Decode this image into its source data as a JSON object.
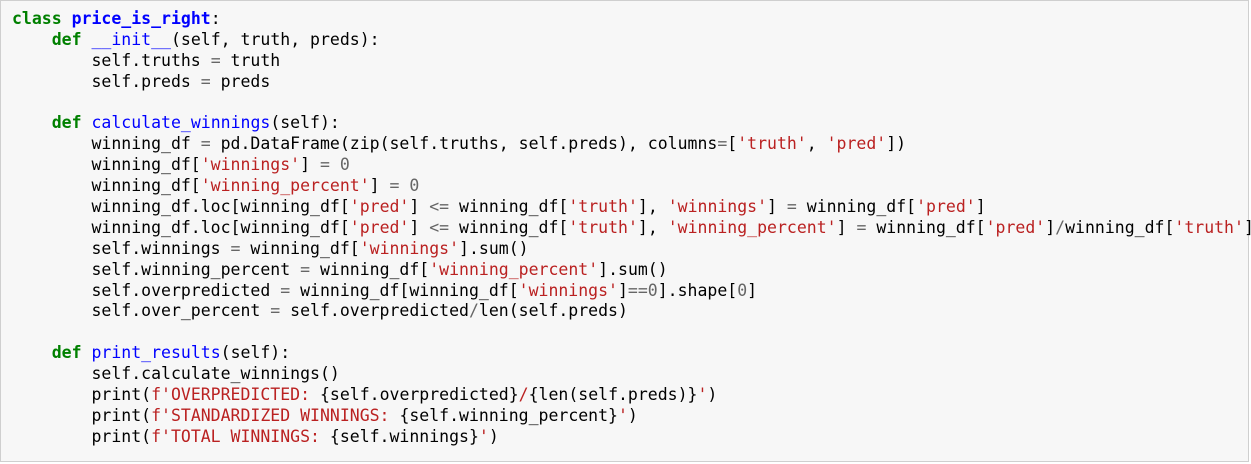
{
  "lines": [
    [
      [
        "k",
        "class"
      ],
      [
        "t",
        " "
      ],
      [
        "c",
        "price_is_right"
      ],
      [
        "t",
        ":"
      ]
    ],
    [
      [
        "t",
        "    "
      ],
      [
        "k",
        "def"
      ],
      [
        "t",
        " "
      ],
      [
        "f",
        "__init__"
      ],
      [
        "t",
        "(self, truth, preds):"
      ]
    ],
    [
      [
        "t",
        "        self.truths "
      ],
      [
        "o",
        "="
      ],
      [
        "t",
        " truth"
      ]
    ],
    [
      [
        "t",
        "        self.preds "
      ],
      [
        "o",
        "="
      ],
      [
        "t",
        " preds"
      ]
    ],
    [
      [
        "t",
        ""
      ]
    ],
    [
      [
        "t",
        "    "
      ],
      [
        "k",
        "def"
      ],
      [
        "t",
        " "
      ],
      [
        "f",
        "calculate_winnings"
      ],
      [
        "t",
        "(self):"
      ]
    ],
    [
      [
        "t",
        "        winning_df "
      ],
      [
        "o",
        "="
      ],
      [
        "t",
        " pd.DataFrame(zip(self.truths, self.preds), columns"
      ],
      [
        "o",
        "="
      ],
      [
        "t",
        "["
      ],
      [
        "s",
        "'truth'"
      ],
      [
        "t",
        ", "
      ],
      [
        "s",
        "'pred'"
      ],
      [
        "t",
        "])"
      ]
    ],
    [
      [
        "t",
        "        winning_df["
      ],
      [
        "s",
        "'winnings'"
      ],
      [
        "t",
        "] "
      ],
      [
        "o",
        "="
      ],
      [
        "t",
        " "
      ],
      [
        "n",
        "0"
      ]
    ],
    [
      [
        "t",
        "        winning_df["
      ],
      [
        "s",
        "'winning_percent'"
      ],
      [
        "t",
        "] "
      ],
      [
        "o",
        "="
      ],
      [
        "t",
        " "
      ],
      [
        "n",
        "0"
      ]
    ],
    [
      [
        "t",
        "        winning_df.loc[winning_df["
      ],
      [
        "s",
        "'pred'"
      ],
      [
        "t",
        "] "
      ],
      [
        "o",
        "<="
      ],
      [
        "t",
        " winning_df["
      ],
      [
        "s",
        "'truth'"
      ],
      [
        "t",
        "], "
      ],
      [
        "s",
        "'winnings'"
      ],
      [
        "t",
        "] "
      ],
      [
        "o",
        "="
      ],
      [
        "t",
        " winning_df["
      ],
      [
        "s",
        "'pred'"
      ],
      [
        "t",
        "]"
      ]
    ],
    [
      [
        "t",
        "        winning_df.loc[winning_df["
      ],
      [
        "s",
        "'pred'"
      ],
      [
        "t",
        "] "
      ],
      [
        "o",
        "<="
      ],
      [
        "t",
        " winning_df["
      ],
      [
        "s",
        "'truth'"
      ],
      [
        "t",
        "], "
      ],
      [
        "s",
        "'winning_percent'"
      ],
      [
        "t",
        "] "
      ],
      [
        "o",
        "="
      ],
      [
        "t",
        " winning_df["
      ],
      [
        "s",
        "'pred'"
      ],
      [
        "t",
        "]"
      ],
      [
        "o",
        "/"
      ],
      [
        "t",
        "winning_df["
      ],
      [
        "s",
        "'truth'"
      ],
      [
        "t",
        "]"
      ]
    ],
    [
      [
        "t",
        "        self.winnings "
      ],
      [
        "o",
        "="
      ],
      [
        "t",
        " winning_df["
      ],
      [
        "s",
        "'winnings'"
      ],
      [
        "t",
        "].sum()"
      ]
    ],
    [
      [
        "t",
        "        self.winning_percent "
      ],
      [
        "o",
        "="
      ],
      [
        "t",
        " winning_df["
      ],
      [
        "s",
        "'winning_percent'"
      ],
      [
        "t",
        "].sum()"
      ]
    ],
    [
      [
        "t",
        "        self.overpredicted "
      ],
      [
        "o",
        "="
      ],
      [
        "t",
        " winning_df[winning_df["
      ],
      [
        "s",
        "'winnings'"
      ],
      [
        "t",
        "]"
      ],
      [
        "o",
        "=="
      ],
      [
        "n",
        "0"
      ],
      [
        "t",
        "].shape["
      ],
      [
        "n",
        "0"
      ],
      [
        "t",
        "]"
      ]
    ],
    [
      [
        "t",
        "        self.over_percent "
      ],
      [
        "o",
        "="
      ],
      [
        "t",
        " self.overpredicted"
      ],
      [
        "o",
        "/"
      ],
      [
        "t",
        "len(self.preds)"
      ]
    ],
    [
      [
        "t",
        ""
      ]
    ],
    [
      [
        "t",
        "    "
      ],
      [
        "k",
        "def"
      ],
      [
        "t",
        " "
      ],
      [
        "f",
        "print_results"
      ],
      [
        "t",
        "(self):"
      ]
    ],
    [
      [
        "t",
        "        self.calculate_winnings()"
      ]
    ],
    [
      [
        "t",
        "        print("
      ],
      [
        "s",
        "f'OVERPREDICTED: "
      ],
      [
        "t",
        "{self.overpredicted}"
      ],
      [
        "s",
        "/"
      ],
      [
        "t",
        "{len(self.preds)}"
      ],
      [
        "s",
        "'"
      ],
      [
        "t",
        ")"
      ]
    ],
    [
      [
        "t",
        "        print("
      ],
      [
        "s",
        "f'STANDARDIZED WINNINGS: "
      ],
      [
        "t",
        "{self.winning_percent}"
      ],
      [
        "s",
        "'"
      ],
      [
        "t",
        ")"
      ]
    ],
    [
      [
        "t",
        "        print("
      ],
      [
        "s",
        "f'TOTAL WINNINGS: "
      ],
      [
        "t",
        "{self.winnings}"
      ],
      [
        "s",
        "'"
      ],
      [
        "t",
        ")"
      ]
    ]
  ]
}
